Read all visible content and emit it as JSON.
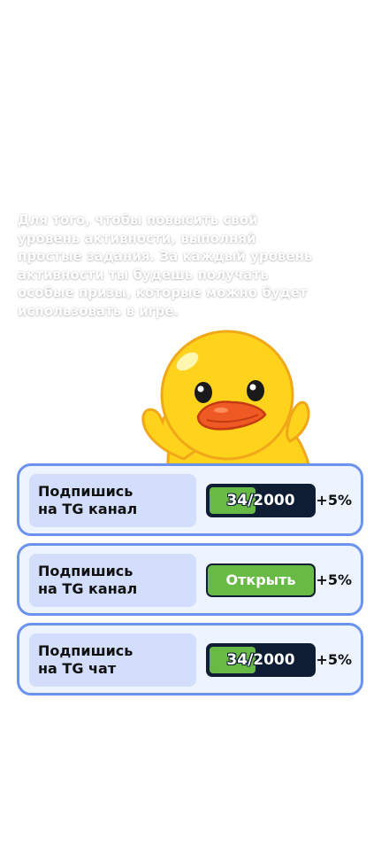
{
  "intro_lines": [
    "Для того, чтобы повысить свой",
    "уровень активности, выполняй",
    "простые задания. За каждый уровень",
    "активности ты будешь получать",
    "особые призы, которые можно будет",
    "использовать в игре."
  ],
  "tasks": [
    {
      "title_line1": "Подпишись",
      "title_line2": "на TG канал",
      "kind": "progress",
      "progress_label": "34/2000",
      "reward": "+5%"
    },
    {
      "title_line1": "Подпишись",
      "title_line2": "на TG канал",
      "kind": "button",
      "button_label": "Открыть",
      "reward": "+5%"
    },
    {
      "title_line1": "Подпишись",
      "title_line2": "на TG чат",
      "kind": "progress",
      "progress_label": "34/2000",
      "reward": "+5%"
    }
  ],
  "colors": {
    "card_border": "#6b93ee",
    "card_bg": "#edf3ff",
    "title_bg": "#d2defb",
    "progress_dark": "#0e1d33",
    "progress_green": "#67bb45"
  }
}
